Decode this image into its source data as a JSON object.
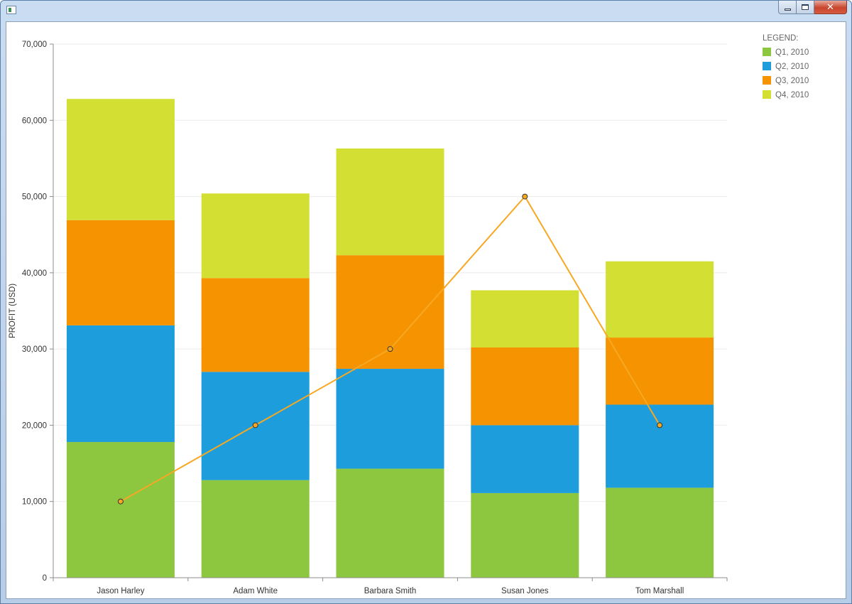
{
  "window": {
    "title": "",
    "icons": {
      "app": "window-icon",
      "minimize": "minimize-icon",
      "maximize": "maximize-icon",
      "close": "close-icon"
    },
    "close_glyph": "✕"
  },
  "chart_data": {
    "type": "bar",
    "stacked": true,
    "categories": [
      "Jason Harley",
      "Adam White",
      "Barbara Smith",
      "Susan Jones",
      "Tom Marshall"
    ],
    "series": [
      {
        "name": "Q1, 2010",
        "color": "#8dc63f",
        "values": [
          17800,
          12800,
          14300,
          11100,
          11800
        ]
      },
      {
        "name": "Q2, 2010",
        "color": "#1d9ddc",
        "values": [
          15300,
          14200,
          13100,
          8900,
          10900
        ]
      },
      {
        "name": "Q3, 2010",
        "color": "#f59400",
        "values": [
          13800,
          12300,
          14900,
          10200,
          8800
        ]
      },
      {
        "name": "Q4, 2010",
        "color": "#d4df33",
        "values": [
          15900,
          11100,
          14000,
          7500,
          10000
        ]
      }
    ],
    "overlay_line": {
      "color": "#f7a823",
      "values": [
        10000,
        20000,
        30000,
        50000,
        20000
      ]
    },
    "ylabel": "PROFIT (USD)",
    "xlabel": "",
    "ylim": [
      0,
      70000
    ],
    "yticks": [
      0,
      10000,
      20000,
      30000,
      40000,
      50000,
      60000,
      70000
    ],
    "ytick_labels": [
      "0",
      "10,000",
      "20,000",
      "30,000",
      "40,000",
      "50,000",
      "60,000",
      "70,000"
    ],
    "grid": true,
    "legend": {
      "title": "LEGEND:",
      "position": "top-right"
    }
  }
}
